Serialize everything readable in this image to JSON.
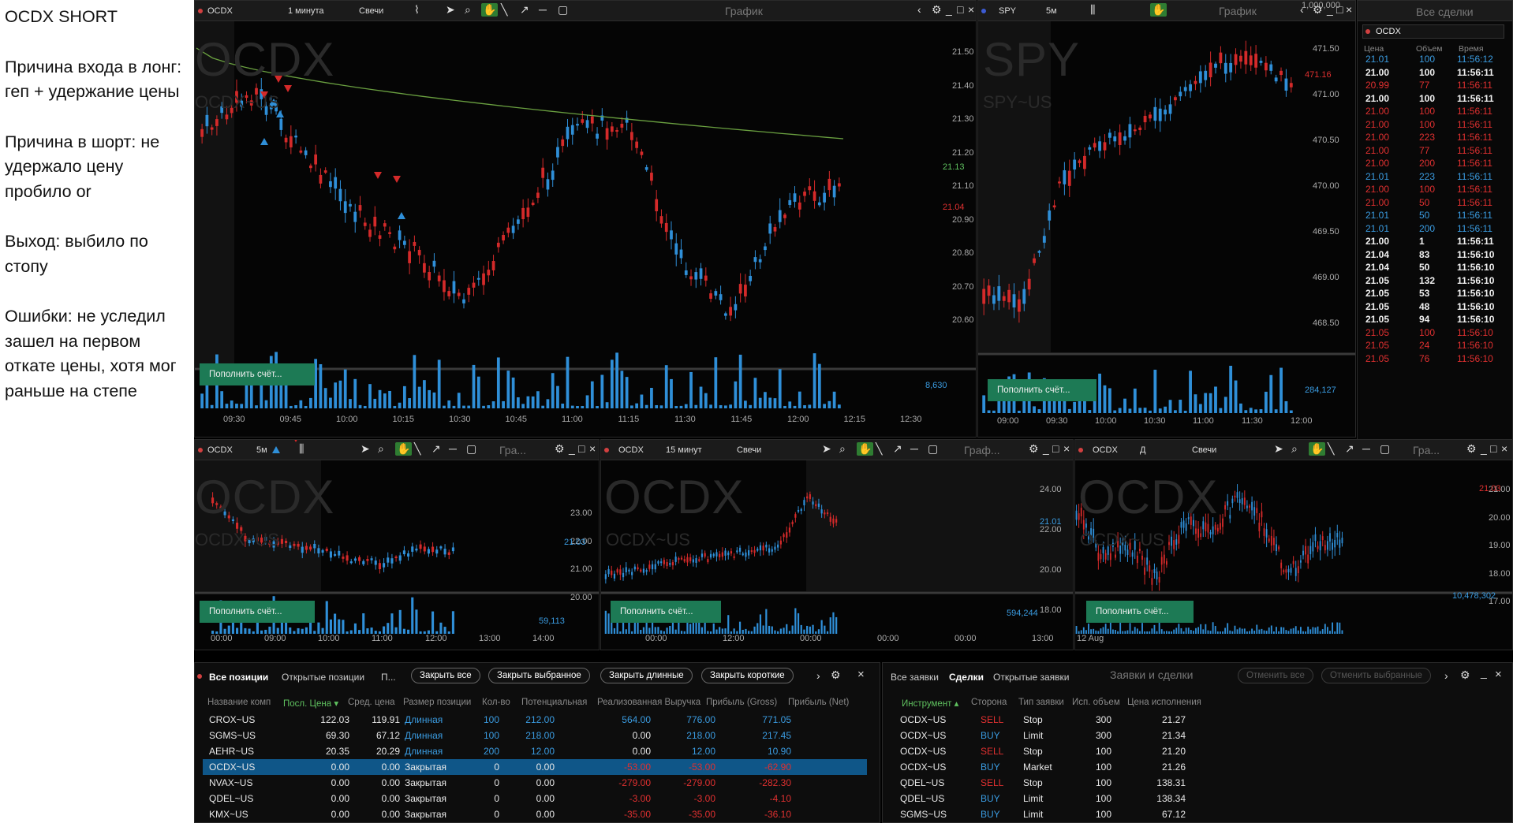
{
  "notes": [
    "OCDX SHORT",
    "Причина входа в лонг: геп + удержание цены",
    "Причина в шорт: не удержало цену пробило or",
    "Выход: выбило по стопу",
    "Ошибки: не уследил зашел на первом откате цены, хотя мог раньше на степе"
  ],
  "fund_button": "Пополнить счёт...",
  "charts": {
    "main": {
      "symbol": "OCDX",
      "interval": "1 минута",
      "type": "Свечи",
      "title": "График",
      "watermark": "OCDX",
      "watermark_sub": "OCDX~US",
      "price_ticks": [
        "21.50",
        "21.40",
        "21.30",
        "21.20",
        "21.10",
        "20.90",
        "20.80",
        "20.70",
        "20.60"
      ],
      "last_price": "21.13",
      "red_price": "21.04",
      "volume_label": "8,630",
      "time_ticks": [
        "09:30",
        "09:45",
        "10:00",
        "10:15",
        "10:30",
        "10:45",
        "11:00",
        "11:15",
        "11:30",
        "11:45",
        "12:00",
        "12:15",
        "12:30"
      ]
    },
    "spy": {
      "symbol": "SPY",
      "interval": "5м",
      "title": "График",
      "watermark": "SPY",
      "watermark_sub": "SPY~US",
      "price_ticks": [
        "471.50",
        "471.00",
        "470.50",
        "470.00",
        "469.50",
        "469.00",
        "468.50"
      ],
      "last_price": "471.16",
      "volume_ticks": [
        "1,000,000"
      ],
      "volume_label": "284,127",
      "time_ticks": [
        "09:00",
        "09:30",
        "10:00",
        "10:30",
        "11:00",
        "11:30",
        "12:00"
      ]
    },
    "ocdx5": {
      "symbol": "OCDX",
      "interval": "5м",
      "title": "Гра...",
      "watermark": "OCDX",
      "watermark_sub": "OCDX~US",
      "price_ticks": [
        "23.00",
        "22.00",
        "21.00",
        "20.00"
      ],
      "last_price": "21.03",
      "volume_label": "59,113",
      "time_ticks": [
        "00:00",
        "09:00",
        "10:00",
        "11:00",
        "12:00",
        "13:00",
        "14:00"
      ]
    },
    "ocdx15": {
      "symbol": "OCDX",
      "interval": "15 минут",
      "type": "Свечи",
      "title": "Граф...",
      "watermark": "OCDX",
      "watermark_sub": "OCDX~US",
      "price_ticks": [
        "24.00",
        "22.00",
        "20.00",
        "18.00"
      ],
      "last_price": "21.01",
      "volume_label": "594,244",
      "time_ticks": [
        "00:00",
        "12:00",
        "00:00",
        "00:00",
        "00:00",
        "13:00"
      ]
    },
    "ocdxd": {
      "symbol": "OCDX",
      "interval": "Д",
      "type": "Свечи",
      "title": "Гра...",
      "watermark": "OCDX",
      "watermark_sub": "OCDX~US",
      "price_ticks": [
        "21.00",
        "20.00",
        "19.00",
        "18.00",
        "17.00"
      ],
      "last_price": "21.03",
      "volume_label": "10,478,302",
      "time_ticks": [
        "12 Aug"
      ]
    }
  },
  "timesales": {
    "title": "Все сделки",
    "symbol": "OCDX",
    "headers": [
      "Цена",
      "Объем",
      "Время"
    ],
    "rows": [
      {
        "p": "21.01",
        "v": "100",
        "t": "11:56:12",
        "c": "blue"
      },
      {
        "p": "21.00",
        "v": "100",
        "t": "11:56:11",
        "c": "white"
      },
      {
        "p": "20.99",
        "v": "77",
        "t": "11:56:11",
        "c": "red"
      },
      {
        "p": "21.00",
        "v": "100",
        "t": "11:56:11",
        "c": "white"
      },
      {
        "p": "21.00",
        "v": "100",
        "t": "11:56:11",
        "c": "red"
      },
      {
        "p": "21.00",
        "v": "100",
        "t": "11:56:11",
        "c": "red"
      },
      {
        "p": "21.00",
        "v": "223",
        "t": "11:56:11",
        "c": "red"
      },
      {
        "p": "21.00",
        "v": "77",
        "t": "11:56:11",
        "c": "red"
      },
      {
        "p": "21.00",
        "v": "200",
        "t": "11:56:11",
        "c": "red"
      },
      {
        "p": "21.01",
        "v": "223",
        "t": "11:56:11",
        "c": "blue"
      },
      {
        "p": "21.00",
        "v": "100",
        "t": "11:56:11",
        "c": "red"
      },
      {
        "p": "21.00",
        "v": "50",
        "t": "11:56:11",
        "c": "red"
      },
      {
        "p": "21.01",
        "v": "50",
        "t": "11:56:11",
        "c": "blue"
      },
      {
        "p": "21.01",
        "v": "200",
        "t": "11:56:11",
        "c": "blue"
      },
      {
        "p": "21.00",
        "v": "1",
        "t": "11:56:11",
        "c": "white"
      },
      {
        "p": "21.04",
        "v": "83",
        "t": "11:56:10",
        "c": "white"
      },
      {
        "p": "21.04",
        "v": "50",
        "t": "11:56:10",
        "c": "white"
      },
      {
        "p": "21.05",
        "v": "132",
        "t": "11:56:10",
        "c": "white"
      },
      {
        "p": "21.05",
        "v": "53",
        "t": "11:56:10",
        "c": "white"
      },
      {
        "p": "21.05",
        "v": "48",
        "t": "11:56:10",
        "c": "white"
      },
      {
        "p": "21.05",
        "v": "94",
        "t": "11:56:10",
        "c": "white"
      },
      {
        "p": "21.05",
        "v": "100",
        "t": "11:56:10",
        "c": "red"
      },
      {
        "p": "21.05",
        "v": "24",
        "t": "11:56:10",
        "c": "red"
      },
      {
        "p": "21.05",
        "v": "76",
        "t": "11:56:10",
        "c": "red"
      }
    ]
  },
  "positions": {
    "tabs": [
      "Все позиции",
      "Открытые позиции",
      "П..."
    ],
    "buttons": [
      "Закрыть все",
      "Закрыть выбранное",
      "Закрыть длинные",
      "Закрыть короткие"
    ],
    "headers": [
      "Название комп",
      "Посл. Цена",
      "Сред. цена",
      "Размер позиции",
      "Кол-во",
      "Потенциальная",
      "Реализованная Выручка",
      "Прибыль (Gross)",
      "Прибыль (Net)"
    ],
    "rows": [
      {
        "n": "CROX~US",
        "last": "122.03",
        "avg": "119.91",
        "side": "Длинная",
        "qty": "100",
        "pot": "212.00",
        "real": "564.00",
        "gross": "776.00",
        "net": "771.05",
        "c": "blue",
        "hl": false
      },
      {
        "n": "SGMS~US",
        "last": "69.30",
        "avg": "67.12",
        "side": "Длинная",
        "qty": "100",
        "pot": "218.00",
        "real": "0.00",
        "gross": "218.00",
        "net": "217.45",
        "c": "blue",
        "hl": false
      },
      {
        "n": "AEHR~US",
        "last": "20.35",
        "avg": "20.29",
        "side": "Длинная",
        "qty": "200",
        "pot": "12.00",
        "real": "0.00",
        "gross": "12.00",
        "net": "10.90",
        "c": "blue",
        "hl": false
      },
      {
        "n": "OCDX~US",
        "last": "0.00",
        "avg": "0.00",
        "side": "Закрытая",
        "qty": "0",
        "pot": "0.00",
        "real": "-53.00",
        "gross": "-53.00",
        "net": "-62.90",
        "c": "red",
        "hl": true
      },
      {
        "n": "NVAX~US",
        "last": "0.00",
        "avg": "0.00",
        "side": "Закрытая",
        "qty": "0",
        "pot": "0.00",
        "real": "-279.00",
        "gross": "-279.00",
        "net": "-282.30",
        "c": "red",
        "hl": false
      },
      {
        "n": "QDEL~US",
        "last": "0.00",
        "avg": "0.00",
        "side": "Закрытая",
        "qty": "0",
        "pot": "0.00",
        "real": "-3.00",
        "gross": "-3.00",
        "net": "-4.10",
        "c": "red",
        "hl": false
      },
      {
        "n": "KMX~US",
        "last": "0.00",
        "avg": "0.00",
        "side": "Закрытая",
        "qty": "0",
        "pot": "0.00",
        "real": "-35.00",
        "gross": "-35.00",
        "net": "-36.10",
        "c": "red",
        "hl": false
      }
    ]
  },
  "orders": {
    "tabs": [
      "Все заявки",
      "Сделки",
      "Открытые заявки"
    ],
    "title": "Заявки и сделки",
    "buttons": [
      "Отменить все",
      "Отменить выбранные"
    ],
    "headers": [
      "Инструмент",
      "Сторона",
      "Тип заявки",
      "Исп. объем",
      "Цена исполнения"
    ],
    "rows": [
      {
        "i": "OCDX~US",
        "s": "SELL",
        "t": "Stop",
        "q": "300",
        "p": "21.27"
      },
      {
        "i": "OCDX~US",
        "s": "BUY",
        "t": "Limit",
        "q": "300",
        "p": "21.34"
      },
      {
        "i": "OCDX~US",
        "s": "SELL",
        "t": "Stop",
        "q": "100",
        "p": "21.20"
      },
      {
        "i": "OCDX~US",
        "s": "BUY",
        "t": "Market",
        "q": "100",
        "p": "21.26"
      },
      {
        "i": "QDEL~US",
        "s": "SELL",
        "t": "Stop",
        "q": "100",
        "p": "138.31"
      },
      {
        "i": "QDEL~US",
        "s": "BUY",
        "t": "Limit",
        "q": "100",
        "p": "138.34"
      },
      {
        "i": "SGMS~US",
        "s": "BUY",
        "t": "Limit",
        "q": "100",
        "p": "67.12"
      }
    ]
  }
}
